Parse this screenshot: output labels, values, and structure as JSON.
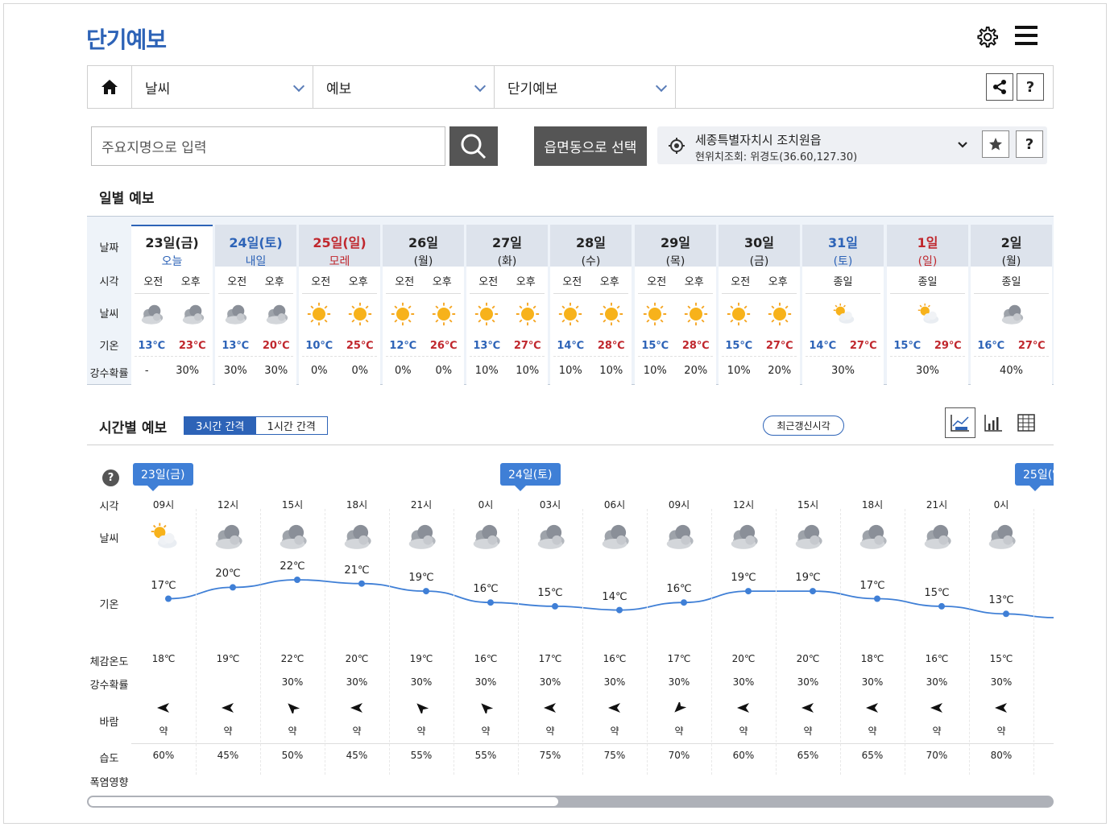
{
  "header": {
    "title": "단기예보"
  },
  "breadcrumb": {
    "items": [
      "날씨",
      "예보",
      "단기예보"
    ]
  },
  "search": {
    "placeholder": "주요지명으로 입력",
    "area_button": "읍면동으로 선택"
  },
  "location": {
    "name": "세종특별자치시 조치원읍",
    "coord": "현위치조회: 위경도(36.60,127.30)"
  },
  "help_label": "?",
  "daily": {
    "title": "일별 예보",
    "row_labels": [
      "날짜",
      "시각",
      "날씨",
      "기온",
      "강수확률"
    ],
    "days": [
      {
        "date": "23일(금)",
        "sub": "오늘",
        "color": "#222222",
        "sub_color": "#2d63b7",
        "periods": [
          "오전",
          "오후"
        ],
        "icons": [
          "cloudy",
          "cloudy"
        ],
        "temps": [
          "13℃",
          "23℃"
        ],
        "pops": [
          "-",
          "30%"
        ]
      },
      {
        "date": "24일(토)",
        "sub": "내일",
        "color": "#2d63b7",
        "sub_color": "#2d63b7",
        "periods": [
          "오전",
          "오후"
        ],
        "icons": [
          "cloudy",
          "cloudy"
        ],
        "temps": [
          "13℃",
          "20℃"
        ],
        "pops": [
          "30%",
          "30%"
        ]
      },
      {
        "date": "25일(일)",
        "sub": "모레",
        "color": "#c0272d",
        "sub_color": "#c0272d",
        "periods": [
          "오전",
          "오후"
        ],
        "icons": [
          "sunny",
          "sunny"
        ],
        "temps": [
          "10℃",
          "25℃"
        ],
        "pops": [
          "0%",
          "0%"
        ]
      },
      {
        "date": "26일",
        "sub": "(월)",
        "color": "#222222",
        "sub_color": "#222222",
        "periods": [
          "오전",
          "오후"
        ],
        "icons": [
          "sunny",
          "sunny"
        ],
        "temps": [
          "12℃",
          "26℃"
        ],
        "pops": [
          "0%",
          "0%"
        ]
      },
      {
        "date": "27일",
        "sub": "(화)",
        "color": "#222222",
        "sub_color": "#222222",
        "periods": [
          "오전",
          "오후"
        ],
        "icons": [
          "sunny",
          "sunny"
        ],
        "temps": [
          "13℃",
          "27℃"
        ],
        "pops": [
          "10%",
          "10%"
        ]
      },
      {
        "date": "28일",
        "sub": "(수)",
        "color": "#222222",
        "sub_color": "#222222",
        "periods": [
          "오전",
          "오후"
        ],
        "icons": [
          "sunny",
          "sunny"
        ],
        "temps": [
          "14℃",
          "28℃"
        ],
        "pops": [
          "10%",
          "10%"
        ]
      },
      {
        "date": "29일",
        "sub": "(목)",
        "color": "#222222",
        "sub_color": "#222222",
        "periods": [
          "오전",
          "오후"
        ],
        "icons": [
          "sunny",
          "sunny"
        ],
        "temps": [
          "15℃",
          "28℃"
        ],
        "pops": [
          "10%",
          "20%"
        ]
      },
      {
        "date": "30일",
        "sub": "(금)",
        "color": "#222222",
        "sub_color": "#222222",
        "periods": [
          "오전",
          "오후"
        ],
        "icons": [
          "sunny",
          "sunny"
        ],
        "temps": [
          "15℃",
          "27℃"
        ],
        "pops": [
          "10%",
          "20%"
        ]
      },
      {
        "date": "31일",
        "sub": "(토)",
        "color": "#2d63b7",
        "sub_color": "#2d63b7",
        "periods": [
          "종일"
        ],
        "icons": [
          "partly"
        ],
        "temps": [
          "14℃",
          "27℃"
        ],
        "pops": [
          "30%"
        ]
      },
      {
        "date": "1일",
        "sub": "(일)",
        "color": "#c0272d",
        "sub_color": "#c0272d",
        "periods": [
          "종일"
        ],
        "icons": [
          "partly"
        ],
        "temps": [
          "15℃",
          "29℃"
        ],
        "pops": [
          "30%"
        ]
      },
      {
        "date": "2일",
        "sub": "(월)",
        "color": "#222222",
        "sub_color": "#222222",
        "periods": [
          "종일"
        ],
        "icons": [
          "cloudy"
        ],
        "temps": [
          "16℃",
          "27℃"
        ],
        "pops": [
          "40%"
        ]
      }
    ]
  },
  "hourly": {
    "title": "시간별 예보",
    "toggle": [
      "3시간 간격",
      "1시간 간격"
    ],
    "refresh_label": "최근갱신시각",
    "row_labels": [
      "시각",
      "날씨",
      "기온",
      "체감온도",
      "강수확률",
      "바람",
      "습도",
      "폭염영향"
    ],
    "date_flags": [
      "23일(금)",
      "24일(토)",
      "25일(일)"
    ],
    "hours": [
      {
        "time": "09시",
        "icon": "partly",
        "temp": 17,
        "feel": "18℃",
        "pop": "",
        "wind_dir": "W",
        "wind": "약",
        "hum": "60%"
      },
      {
        "time": "12시",
        "icon": "cloudy",
        "temp": 20,
        "feel": "19℃",
        "pop": "",
        "wind_dir": "W",
        "wind": "약",
        "hum": "45%"
      },
      {
        "time": "15시",
        "icon": "cloudy",
        "temp": 22,
        "feel": "22℃",
        "pop": "30%",
        "wind_dir": "NW",
        "wind": "약",
        "hum": "50%"
      },
      {
        "time": "18시",
        "icon": "cloudy",
        "temp": 21,
        "feel": "20℃",
        "pop": "30%",
        "wind_dir": "W",
        "wind": "약",
        "hum": "45%"
      },
      {
        "time": "21시",
        "icon": "cloudy",
        "temp": 19,
        "feel": "19℃",
        "pop": "30%",
        "wind_dir": "NW",
        "wind": "약",
        "hum": "55%"
      },
      {
        "time": "0시",
        "icon": "cloudy",
        "temp": 16,
        "feel": "16℃",
        "pop": "30%",
        "wind_dir": "NW",
        "wind": "약",
        "hum": "55%"
      },
      {
        "time": "03시",
        "icon": "cloudy",
        "temp": 15,
        "feel": "17℃",
        "pop": "30%",
        "wind_dir": "W",
        "wind": "약",
        "hum": "75%"
      },
      {
        "time": "06시",
        "icon": "cloudy",
        "temp": 14,
        "feel": "16℃",
        "pop": "30%",
        "wind_dir": "W",
        "wind": "약",
        "hum": "75%"
      },
      {
        "time": "09시",
        "icon": "cloudy",
        "temp": 16,
        "feel": "17℃",
        "pop": "30%",
        "wind_dir": "SW",
        "wind": "약",
        "hum": "70%"
      },
      {
        "time": "12시",
        "icon": "cloudy",
        "temp": 19,
        "feel": "20℃",
        "pop": "30%",
        "wind_dir": "W",
        "wind": "약",
        "hum": "60%"
      },
      {
        "time": "15시",
        "icon": "cloudy",
        "temp": 19,
        "feel": "20℃",
        "pop": "30%",
        "wind_dir": "W",
        "wind": "약",
        "hum": "65%"
      },
      {
        "time": "18시",
        "icon": "cloudy",
        "temp": 17,
        "feel": "18℃",
        "pop": "30%",
        "wind_dir": "W",
        "wind": "약",
        "hum": "65%"
      },
      {
        "time": "21시",
        "icon": "cloudy",
        "temp": 15,
        "feel": "16℃",
        "pop": "30%",
        "wind_dir": "W",
        "wind": "약",
        "hum": "70%"
      },
      {
        "time": "0시",
        "icon": "cloudy",
        "temp": 13,
        "feel": "15℃",
        "pop": "30%",
        "wind_dir": "W",
        "wind": "약",
        "hum": "80%"
      }
    ],
    "temp_after_last": 12
  },
  "colors": {
    "brand": "#2d63b7",
    "flag": "#3f7fd6",
    "sun": "#f5a623",
    "cloud": "#8a8f98"
  }
}
